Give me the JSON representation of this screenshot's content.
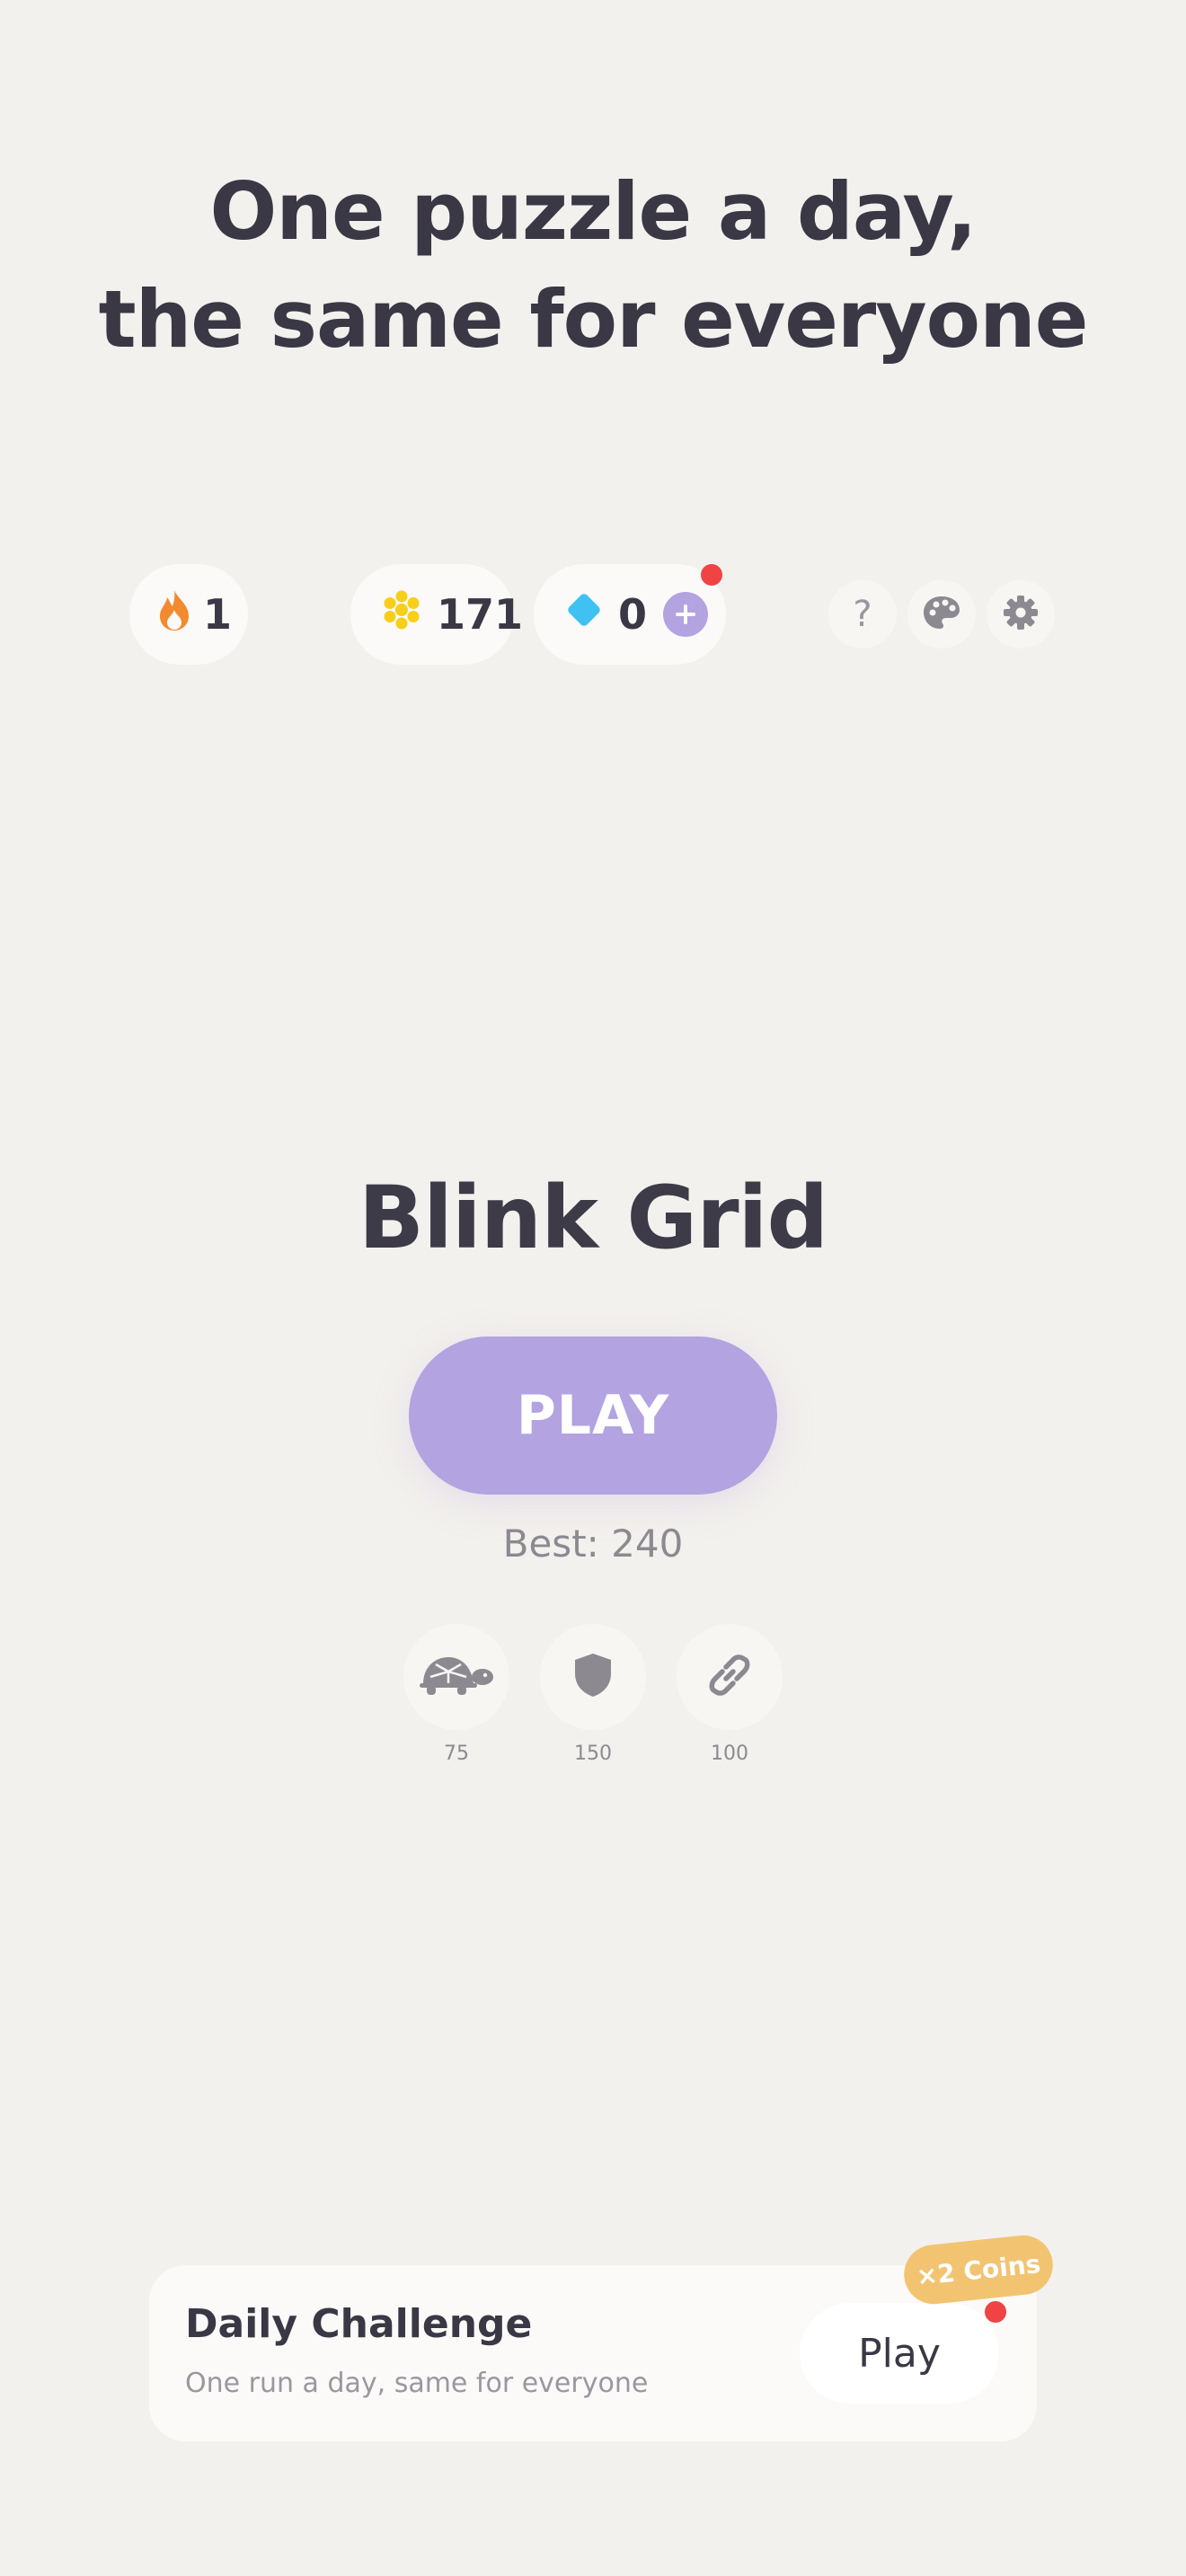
{
  "headline": {
    "line1": "One puzzle a day,",
    "line2": "the same for everyone"
  },
  "stats": {
    "streak": "1",
    "coins": "171",
    "gems": "0"
  },
  "colors": {
    "background": "#f3f1ed",
    "accent": "#b3a3e1",
    "streak_flame": "#f38a2e",
    "coin": "#f7cf1a",
    "gem": "#3fc2f2",
    "notification": "#f04444",
    "bonus_badge": "#f2c472"
  },
  "icons": {
    "streak": "flame-icon",
    "coins": "coin-cluster-icon",
    "gems": "diamond-icon",
    "add": "plus-icon",
    "help": "question-icon",
    "theme": "palette-icon",
    "settings": "gear-icon"
  },
  "header_buttons": {
    "help_label": "?"
  },
  "game": {
    "title": "Blink Grid",
    "play_label": "PLAY",
    "best_label": "Best: 240"
  },
  "powerups": [
    {
      "name": "slow",
      "icon": "turtle-icon",
      "count": "75"
    },
    {
      "name": "shield",
      "icon": "shield-icon",
      "count": "150"
    },
    {
      "name": "link",
      "icon": "link-icon",
      "count": "100"
    }
  ],
  "daily_challenge": {
    "title": "Daily Challenge",
    "subtitle": "One run a day, same for everyone",
    "play_label": "Play",
    "badge": "×2 Coins"
  }
}
